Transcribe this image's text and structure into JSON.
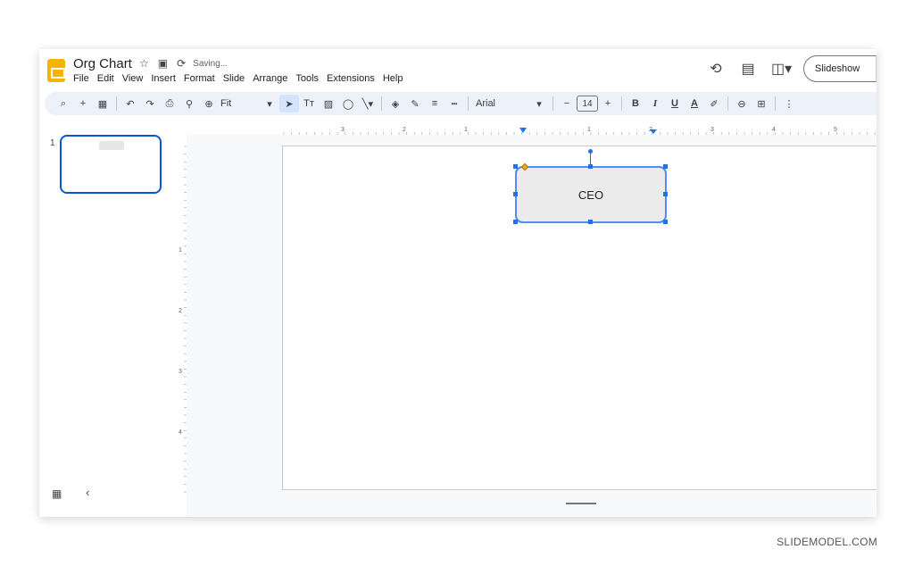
{
  "app": {
    "doc_title": "Org Chart",
    "status": "Saving...",
    "menu": [
      "File",
      "Edit",
      "View",
      "Insert",
      "Format",
      "Slide",
      "Arrange",
      "Tools",
      "Extensions",
      "Help"
    ],
    "slideshow_label": "Slideshow"
  },
  "toolbar": {
    "zoom_value": "Fit",
    "font_name": "Arial",
    "font_size": "14",
    "bold_label": "B",
    "italic_label": "I",
    "underline_label": "U",
    "text_color_label": "A"
  },
  "filmstrip": {
    "slide_number": "1"
  },
  "rulers": {
    "top_labels": [
      "3",
      "2",
      "1",
      "1",
      "2",
      "3",
      "4",
      "5"
    ],
    "left_labels": [
      "1",
      "2",
      "3",
      "4"
    ]
  },
  "slide": {
    "shape_text": "CEO"
  },
  "icons": {
    "star": "star-icon",
    "folder": "move-to-folder-icon",
    "sync": "saving-sync-icon",
    "history": "version-history-icon",
    "comments": "comments-icon",
    "meet": "video-call-icon"
  },
  "colors": {
    "logo": "#f4b400",
    "accent": "#0b57d0",
    "toolbar_bg": "#edf2fa",
    "selection": "#1a73e8"
  },
  "watermark": "SLIDEMODEL.COM"
}
